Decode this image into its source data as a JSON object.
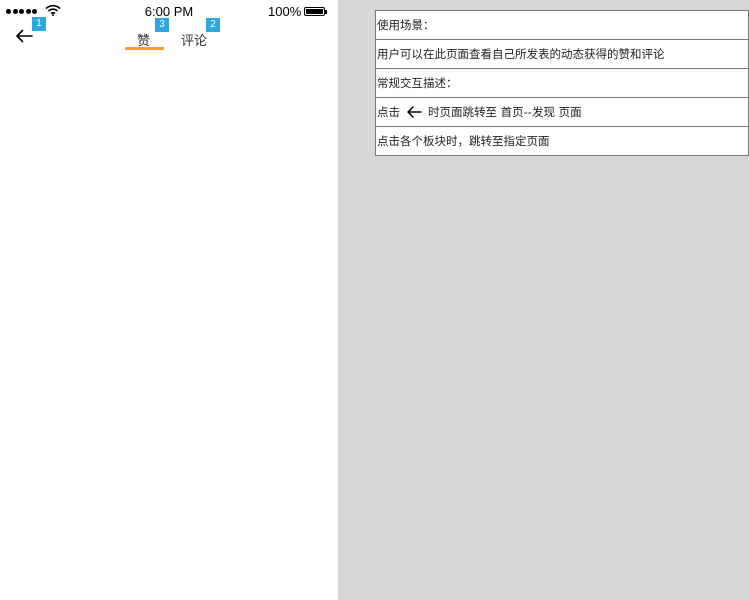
{
  "status_bar": {
    "time": "6:00 PM",
    "battery": "100%"
  },
  "nav": {
    "back_icon": "arrow-left-icon",
    "badges": {
      "back": "1",
      "like_tab": "3",
      "comment_tab": "2"
    },
    "tabs": [
      {
        "label": "赞",
        "active": true
      },
      {
        "label": "评论",
        "active": false
      }
    ],
    "accent_color": "#f2a11f",
    "badge_color": "#2ea7e0"
  },
  "notes": {
    "usage_title": "使用场景：",
    "usage_desc": "用户可以在此页面查看自己所发表的动态获得的赞和评论",
    "interaction_title": "常规交互描述：",
    "back_desc_prefix": "点击",
    "back_desc_suffix": "时页面跳转至 首页--发现 页面",
    "block_desc": "点击各个板块时，跳转至指定页面"
  }
}
